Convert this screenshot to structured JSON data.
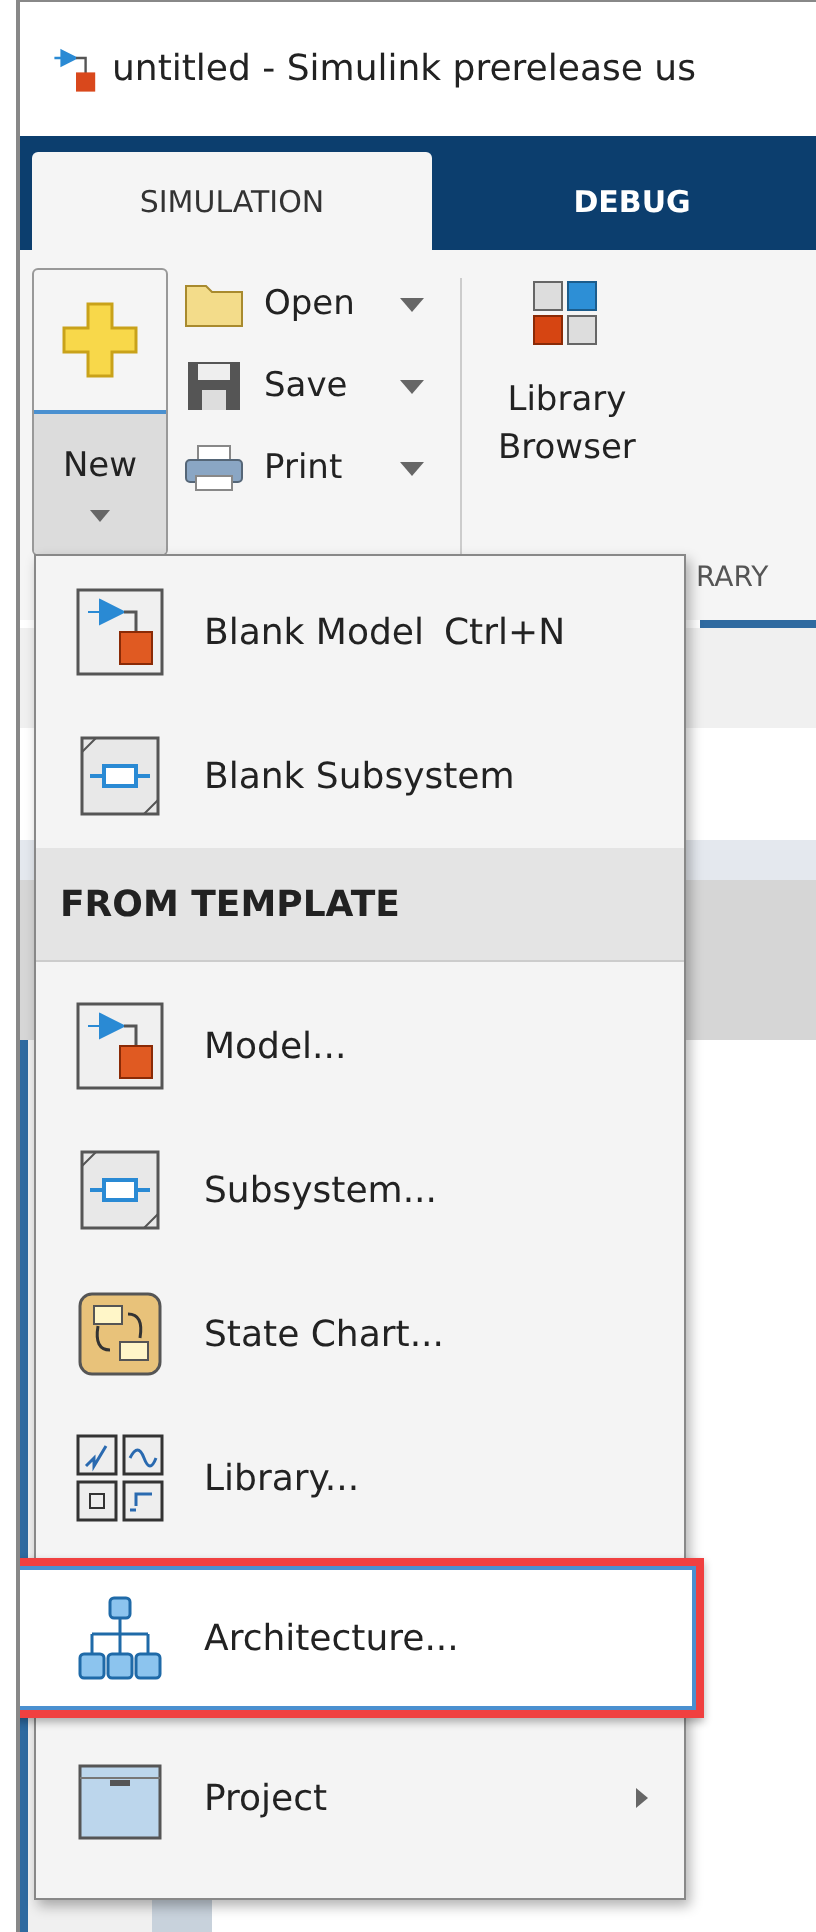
{
  "window": {
    "title": "untitled - Simulink prerelease us"
  },
  "tabs": [
    {
      "label": "SIMULATION",
      "selected": true
    },
    {
      "label": "DEBUG",
      "selected": false
    }
  ],
  "toolstrip": {
    "new_button": "New",
    "file_buttons": [
      "Open",
      "Save",
      "Print"
    ],
    "library_button": [
      "Library",
      "Browser"
    ],
    "section_label": "RARY"
  },
  "menu": {
    "items": [
      {
        "kind": "model",
        "label": "Blank Model",
        "shortcut": "Ctrl+N",
        "selected": false
      },
      {
        "kind": "subsystem",
        "label": "Blank Subsystem",
        "selected": false
      },
      {
        "kind": "header",
        "label": "FROM TEMPLATE"
      },
      {
        "kind": "model",
        "label": "Model...",
        "selected": false
      },
      {
        "kind": "subsystem",
        "label": "Subsystem...",
        "selected": false
      },
      {
        "kind": "statechart",
        "label": "State Chart...",
        "selected": false
      },
      {
        "kind": "library",
        "label": "Library...",
        "selected": false
      },
      {
        "kind": "architecture",
        "label": "Architecture...",
        "selected": true
      },
      {
        "kind": "project",
        "label": "Project",
        "submenu": true,
        "selected": false
      }
    ]
  }
}
